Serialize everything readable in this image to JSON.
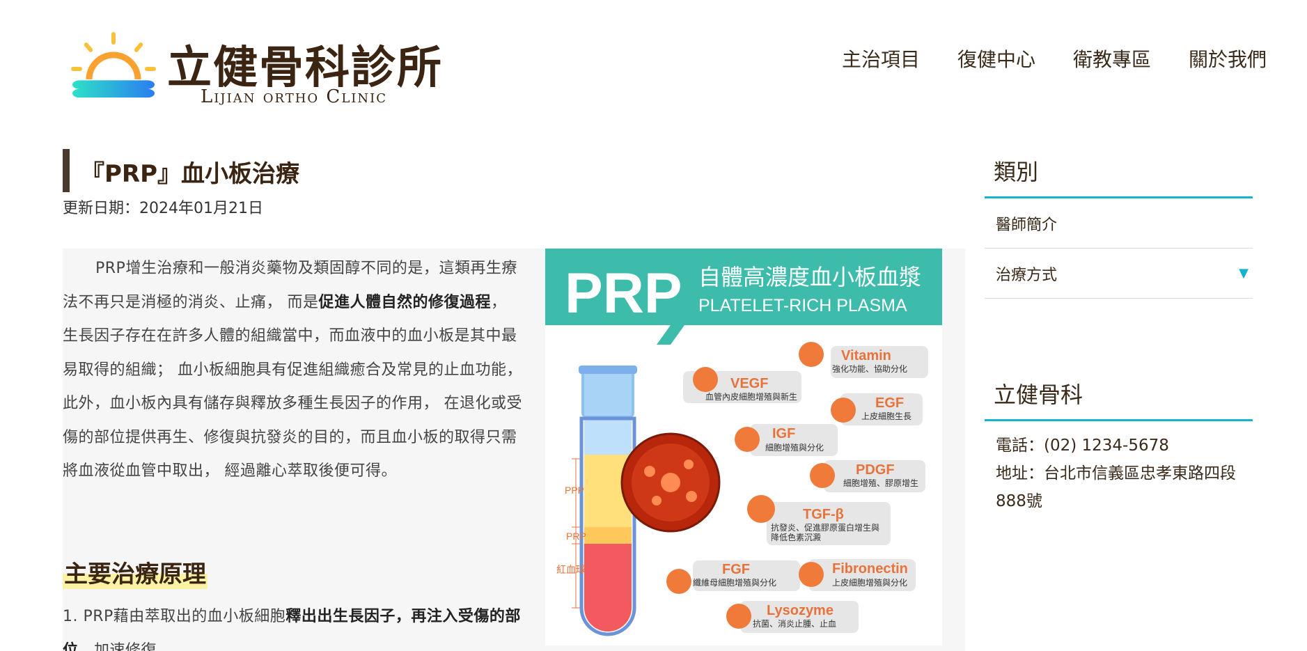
{
  "header": {
    "logo": {
      "name_cn": "立健骨科診所",
      "name_en": "Lijian ortho Clinic"
    },
    "nav": [
      {
        "label": "主治項目"
      },
      {
        "label": "復健中心"
      },
      {
        "label": "衛教專區"
      },
      {
        "label": "關於我們"
      }
    ]
  },
  "article": {
    "title": "『PRP』血小板治療",
    "updated": "更新日期：2024年01月21日",
    "intro": {
      "part1": "PRP增生治療和一般消炎藥物及類固醇不同的是，這類再生療法不再只是消極的消炎、止痛， 而是",
      "bold1": "促進人體自然的修復過程",
      "part2": "，生長因子存在在許多人體的組織當中，而血液中的血小板是其中最易取得的組織； 血小板細胞具有促進組織癒合及常見的止血功能，此外，血小板內具有儲存與釋放多種生長因子的作用， 在退化或受傷的部位提供再生、修復與抗發炎的目的，而且血小板的取得只需將血液從血管中取出， 經過離心萃取後便可得。"
    },
    "section_heading": "主要治療原理",
    "item1": {
      "part1": "1. PRP藉由萃取出的血小板細胞",
      "bold": "釋出出生長因子，再注入受傷的部位",
      "part2": "，加速修復。"
    }
  },
  "figure": {
    "banner_big": "PRP",
    "banner_cn": "自體高濃度血小板血漿",
    "banner_en": "PLATELET-RICH PLASMA",
    "tube_labels": {
      "ppp": "PPP",
      "prp": "PRP",
      "rbc": "紅血球"
    },
    "factors": [
      {
        "name": "Vitamin",
        "desc": "強化功能、協助分化"
      },
      {
        "name": "VEGF",
        "desc": "血管內皮細胞增殖與新生"
      },
      {
        "name": "EGF",
        "desc": "上皮細胞生長"
      },
      {
        "name": "IGF",
        "desc": "細胞增殖與分化"
      },
      {
        "name": "PDGF",
        "desc": "細胞增殖、膠原增生"
      },
      {
        "name": "TGF-β",
        "desc": "抗發炎、促進膠原蛋白增生與",
        "desc2": "降低色素沉澱"
      },
      {
        "name": "FGF",
        "desc": "纖維母細胞增殖與分化"
      },
      {
        "name": "Fibronectin",
        "desc": "上皮細胞增殖與分化"
      },
      {
        "name": "Lysozyme",
        "desc": "抗菌、消炎止腫、止血"
      }
    ],
    "colors": {
      "teal": "#3dbcab",
      "orange": "#f07a3a",
      "label_orange": "#e8733a"
    }
  },
  "sidebar": {
    "category_title": "類別",
    "items": [
      {
        "label": "醫師簡介"
      },
      {
        "label": "治療方式",
        "arrow": "▼"
      }
    ],
    "clinic_title": "立健骨科",
    "phone": "電話：(02) 1234-5678",
    "address": "地址：台北市信義區忠孝東路四段888號"
  },
  "colors": {
    "accent": "#16b3cf",
    "brown": "#3b2412",
    "highlight": "#fbf3a3"
  }
}
